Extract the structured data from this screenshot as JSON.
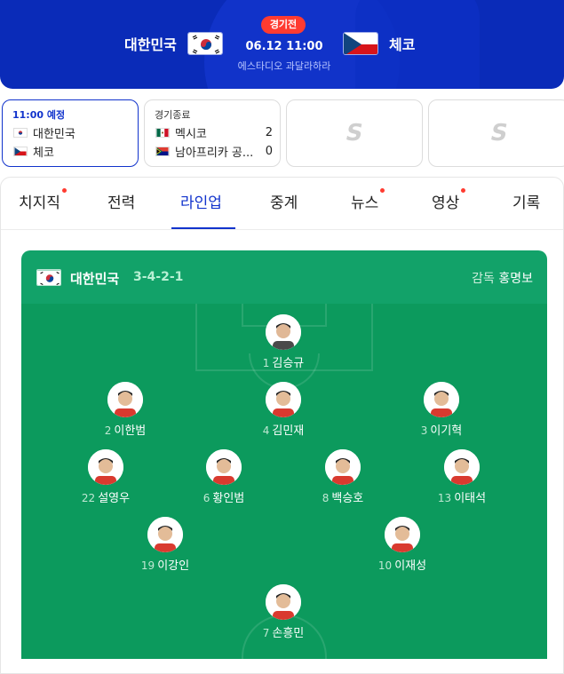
{
  "header": {
    "home_team": "대한민국",
    "away_team": "체코",
    "badge": "경기전",
    "datetime": "06.12 11:00",
    "venue": "에스타디오 과달라하라"
  },
  "match_cards": [
    {
      "status": "11:00 예정",
      "team1": "대한민국",
      "team2": "체코",
      "score1": "",
      "score2": ""
    },
    {
      "status": "경기종료",
      "team1": "멕시코",
      "team2": "남아프리카 공...",
      "score1": "2",
      "score2": "0"
    }
  ],
  "tabs": [
    {
      "label": "치지직",
      "dot": true
    },
    {
      "label": "전력",
      "dot": false
    },
    {
      "label": "라인업",
      "dot": false
    },
    {
      "label": "중계",
      "dot": false
    },
    {
      "label": "뉴스",
      "dot": true
    },
    {
      "label": "영상",
      "dot": true
    },
    {
      "label": "기록",
      "dot": false
    }
  ],
  "lineup": {
    "team": "대한민국",
    "formation": "3-4-2-1",
    "coach_label": "감독",
    "coach_name": "홍명보",
    "players": [
      {
        "number": "1",
        "name": "김승규"
      },
      {
        "number": "2",
        "name": "이한범"
      },
      {
        "number": "4",
        "name": "김민재"
      },
      {
        "number": "3",
        "name": "이기혁"
      },
      {
        "number": "22",
        "name": "설영우"
      },
      {
        "number": "6",
        "name": "황인범"
      },
      {
        "number": "8",
        "name": "백승호"
      },
      {
        "number": "13",
        "name": "이태석"
      },
      {
        "number": "19",
        "name": "이강인"
      },
      {
        "number": "10",
        "name": "이재성"
      },
      {
        "number": "7",
        "name": "손흥민"
      }
    ]
  },
  "colors": {
    "header_bg": "#0a2bb8",
    "accent": "#1133cc",
    "badge": "#ff3b30",
    "pitch": "#0c9a5d"
  }
}
